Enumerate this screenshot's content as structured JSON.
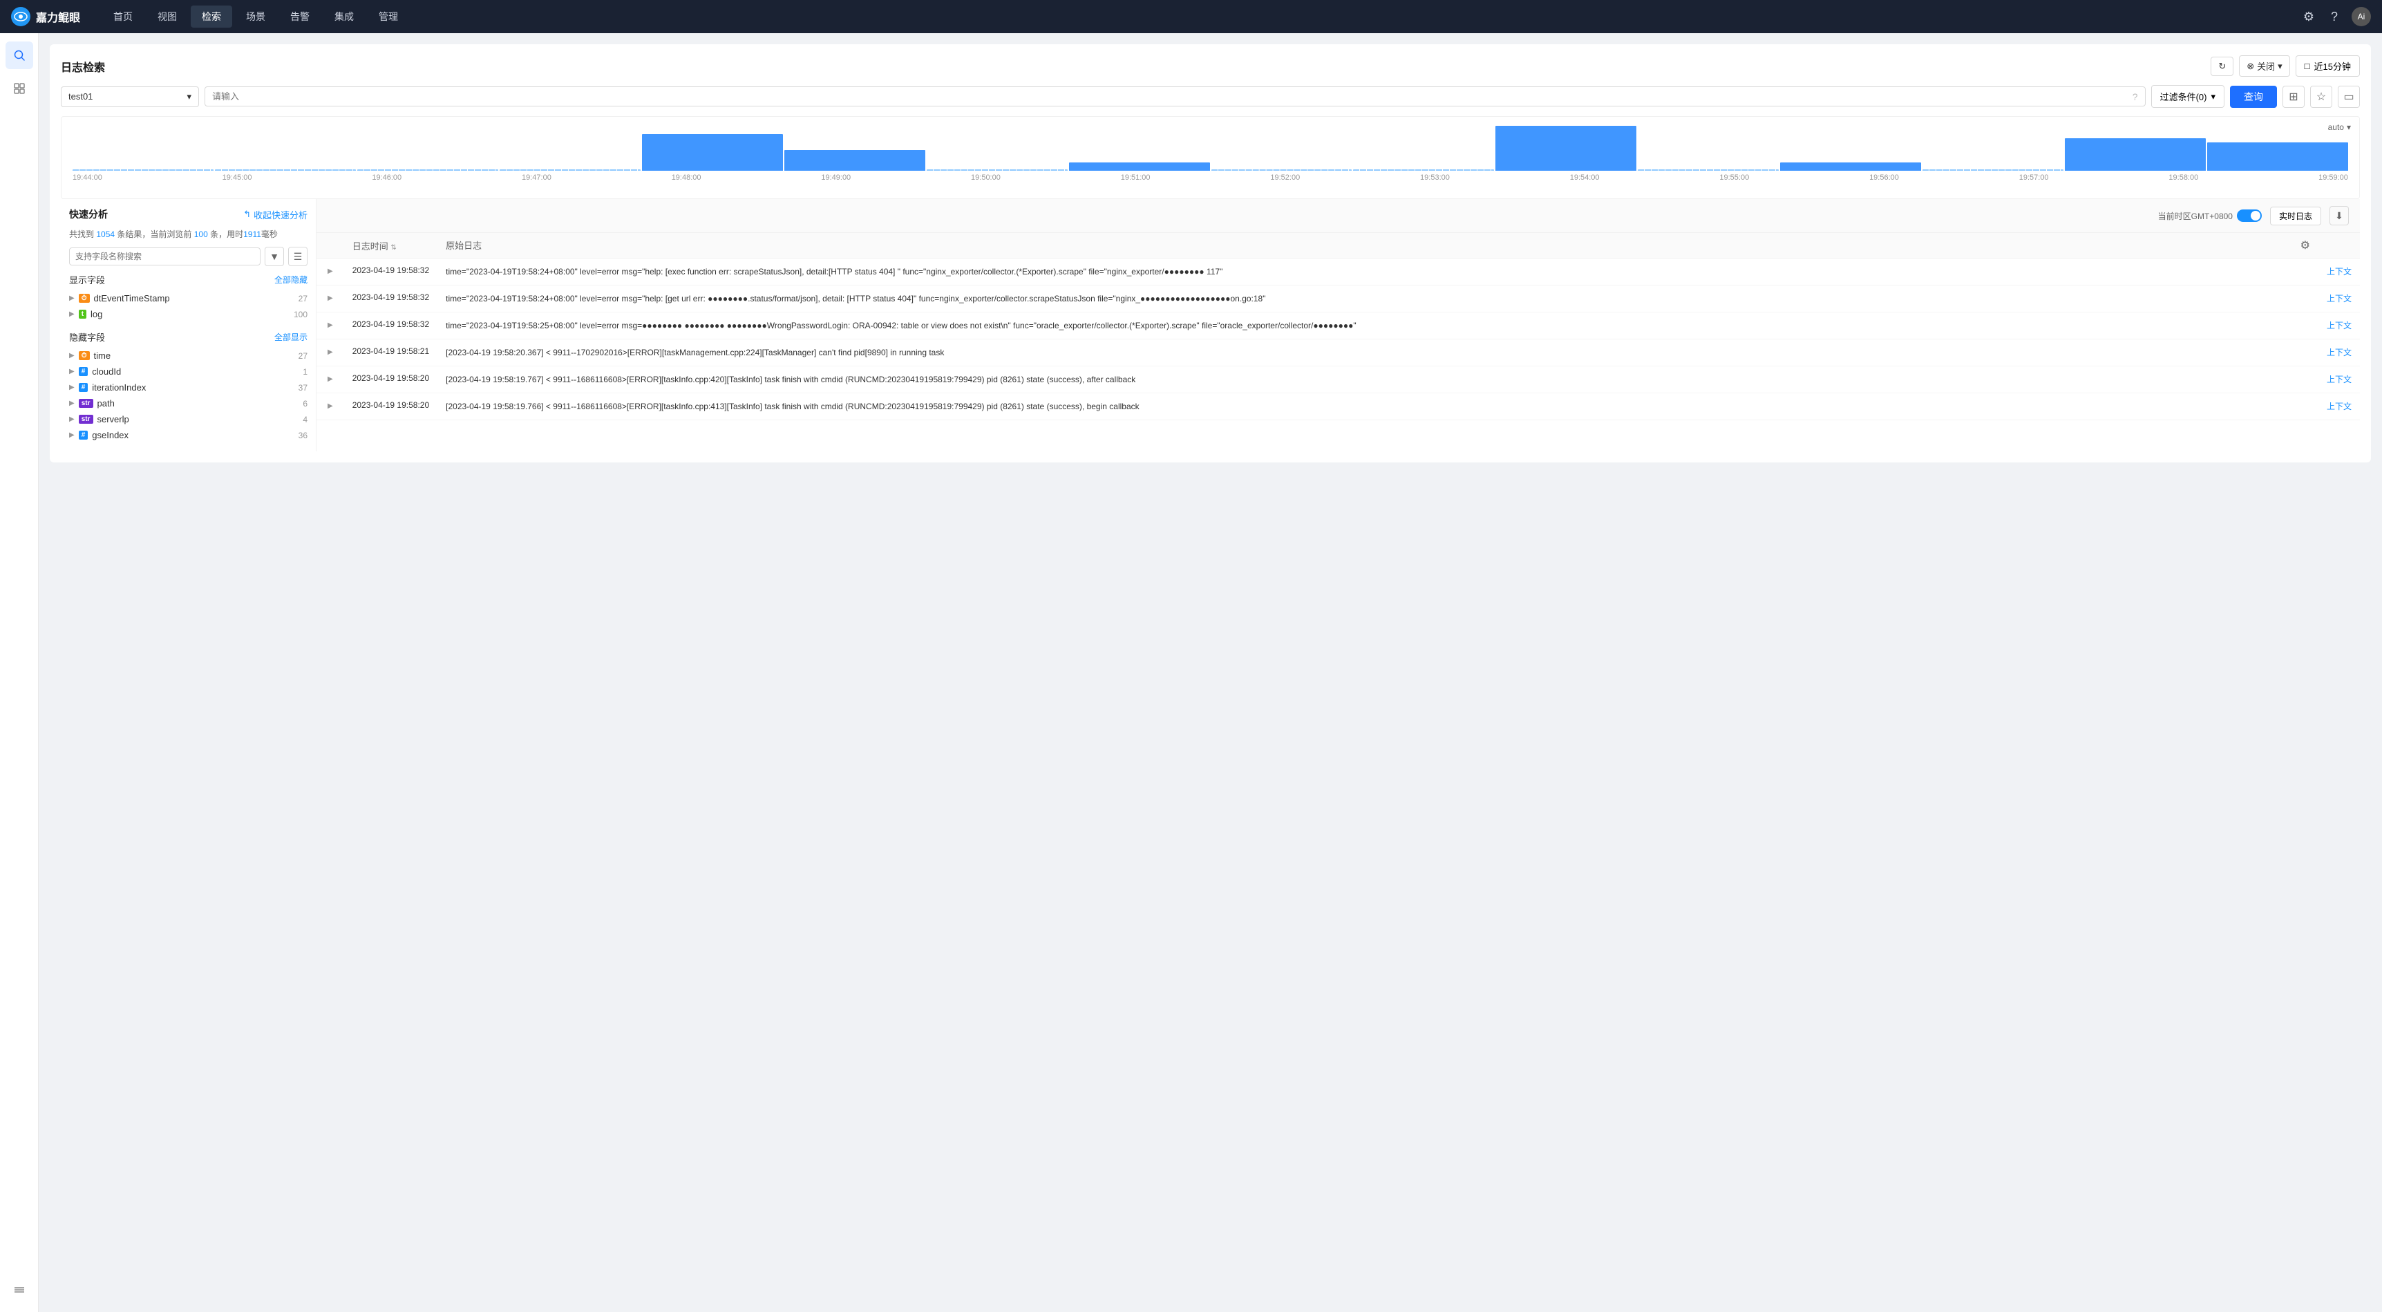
{
  "app": {
    "logo_text": "嘉力鲲眼",
    "logo_short": "鲲"
  },
  "nav": {
    "items": [
      {
        "label": "首页",
        "active": false
      },
      {
        "label": "视图",
        "active": false
      },
      {
        "label": "检索",
        "active": true
      },
      {
        "label": "场景",
        "active": false
      },
      {
        "label": "告警",
        "active": false
      },
      {
        "label": "集成",
        "active": false
      },
      {
        "label": "管理",
        "active": false
      }
    ]
  },
  "panel": {
    "title": "日志检索",
    "close_label": "关闭",
    "time_label": "近15分钟",
    "datasource": "test01",
    "search_placeholder": "请输入",
    "filter_label": "过滤条件(0)",
    "query_label": "查询",
    "auto_label": "auto",
    "chart_timestamps": [
      "19:44:00",
      "19:45:00",
      "19:46:00",
      "19:47:00",
      "19:48:00",
      "19:49:00",
      "19:50:00",
      "19:51:00",
      "19:52:00",
      "19:53:00",
      "19:54:00",
      "19:55:00",
      "19:56:00",
      "19:57:00",
      "19:58:00",
      "19:59:00"
    ],
    "chart_bars": [
      2,
      2,
      2,
      2,
      18,
      10,
      3,
      4,
      2,
      3,
      22,
      3,
      4,
      3,
      16,
      14
    ],
    "results_summary": "共找到 1054 条结果，当前浏览前 100 条，用时1911毫秒",
    "results_count": "1054",
    "results_current": "100",
    "results_time": "1911",
    "timezone_label": "当前时区GMT+0800",
    "realtime_label": "实时日志",
    "collapse_label": "收起快速分析"
  },
  "quick_analysis": {
    "title": "快速分析",
    "search_placeholder": "支持字段名称搜索",
    "display_fields_title": "显示字段",
    "hide_all_label": "全部隐藏",
    "hidden_fields_title": "隐藏字段",
    "show_all_label": "全部显示",
    "display_fields": [
      {
        "name": "dtEventTimeStamp",
        "type": "clock",
        "count": "27"
      },
      {
        "name": "log",
        "type": "t",
        "count": "100"
      }
    ],
    "hidden_fields": [
      {
        "name": "time",
        "type": "clock",
        "count": "27"
      },
      {
        "name": "cloudId",
        "type": "hash",
        "count": "1"
      },
      {
        "name": "iterationIndex",
        "type": "hash",
        "count": "37"
      },
      {
        "name": "path",
        "type": "str",
        "count": "6"
      },
      {
        "name": "serverlp",
        "type": "str",
        "count": "4"
      },
      {
        "name": "gseIndex",
        "type": "hash",
        "count": "36"
      }
    ]
  },
  "log_table": {
    "col_time": "日志时间",
    "col_log": "原始日志",
    "rows": [
      {
        "time": "2023-04-19 19:58:32",
        "content": "time=\"2023-04-19T19:58:24+08:00\" level=error msg=\"help: [exec function err: scrapeStatusJson], detail:[HTTP status 404] \" func=\"nginx_exporter/collector.(*Exporter).scrape\" file=\"nginx_exporter/●●●●●●●● 117\""
      },
      {
        "time": "2023-04-19 19:58:32",
        "content": "time=\"2023-04-19T19:58:24+08:00\" level=error msg=\"help: [get url err: ●●●●●●●●.status/format/json], detail: [HTTP status 404]\" func=nginx_exporter/collector.scrapeStatusJson file=\"nginx_●●●●●●●●●●●●●●●●●●on.go:18\""
      },
      {
        "time": "2023-04-19 19:58:32",
        "content": "time=\"2023-04-19T19:58:25+08:00\" level=error msg=●●●●●●●● ●●●●●●●● ●●●●●●●●WrongPasswordLogin: ORA-00942: table or view does not exist\\n\" func=\"oracle_exporter/collector.(*Exporter).scrape\" file=\"oracle_exporter/collector/●●●●●●●●\""
      },
      {
        "time": "2023-04-19 19:58:21",
        "content": "[2023-04-19 19:58:20.367] < 9911--1702902016>[ERROR][taskManagement.cpp:224][TaskManager] can't find pid[9890] in running task"
      },
      {
        "time": "2023-04-19 19:58:20",
        "content": "[2023-04-19 19:58:19.767] < 9911--1686116608>[ERROR][taskInfo.cpp:420][TaskInfo] task finish with cmdid (RUNCMD:20230419195819:799429) pid (8261) state  (success), after callback"
      },
      {
        "time": "2023-04-19 19:58:20",
        "content": "[2023-04-19 19:58:19.766] < 9911--1686116608>[ERROR][taskInfo.cpp:413][TaskInfo] task finish with cmdid (RUNCMD:20230419195819:799429) pid (8261) state  (success), begin callback"
      }
    ],
    "context_label": "上下文"
  }
}
